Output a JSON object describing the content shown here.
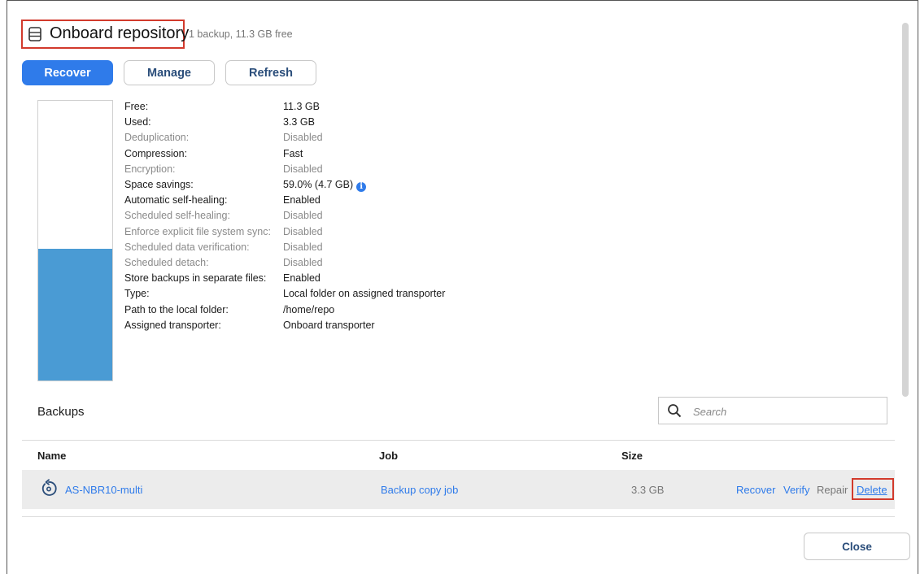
{
  "header": {
    "title": "Onboard repository",
    "subtitle": "1 backup, 11.3 GB free"
  },
  "toolbar": {
    "recover_label": "Recover",
    "manage_label": "Manage",
    "refresh_label": "Refresh"
  },
  "gauge": {
    "used_fraction": 0.47,
    "fill_color": "#4a9bd4"
  },
  "properties": [
    {
      "label": "Free:",
      "value": "11.3 GB",
      "active": true
    },
    {
      "label": "Used:",
      "value": "3.3 GB",
      "active": true
    },
    {
      "label": "Deduplication:",
      "value": "Disabled",
      "active": false
    },
    {
      "label": "Compression:",
      "value": "Fast",
      "active": true
    },
    {
      "label": "Encryption:",
      "value": "Disabled",
      "active": false
    },
    {
      "label": "Space savings:",
      "value": "59.0% (4.7 GB)",
      "active": true
    },
    {
      "label": "Automatic self-healing:",
      "value": "Enabled",
      "active": true
    },
    {
      "label": "Scheduled self-healing:",
      "value": "Disabled",
      "active": false
    },
    {
      "label": "Enforce explicit file system sync:",
      "value": "Disabled",
      "active": false
    },
    {
      "label": "Scheduled data verification:",
      "value": "Disabled",
      "active": false
    },
    {
      "label": "Scheduled detach:",
      "value": "Disabled",
      "active": false
    },
    {
      "label": "Store backups in separate files:",
      "value": "Enabled",
      "active": true
    },
    {
      "label": "Type:",
      "value": "Local folder on assigned transporter",
      "active": true
    },
    {
      "label": "Path to the local folder:",
      "value": "/home/repo",
      "active": true
    },
    {
      "label": "Assigned transporter:",
      "value": "Onboard transporter",
      "active": true
    }
  ],
  "backups": {
    "section_title": "Backups",
    "search_placeholder": "Search",
    "columns": {
      "name": "Name",
      "job": "Job",
      "size": "Size"
    },
    "rows": [
      {
        "name": "AS-NBR10-multi",
        "job": "Backup copy job",
        "size": "3.3 GB",
        "actions": {
          "recover": "Recover",
          "verify": "Verify",
          "repair": "Repair",
          "delete": "Delete"
        }
      }
    ]
  },
  "footer": {
    "close_label": "Close"
  },
  "colors": {
    "accent": "#2f7bea",
    "highlight_box": "#d23a2c"
  }
}
